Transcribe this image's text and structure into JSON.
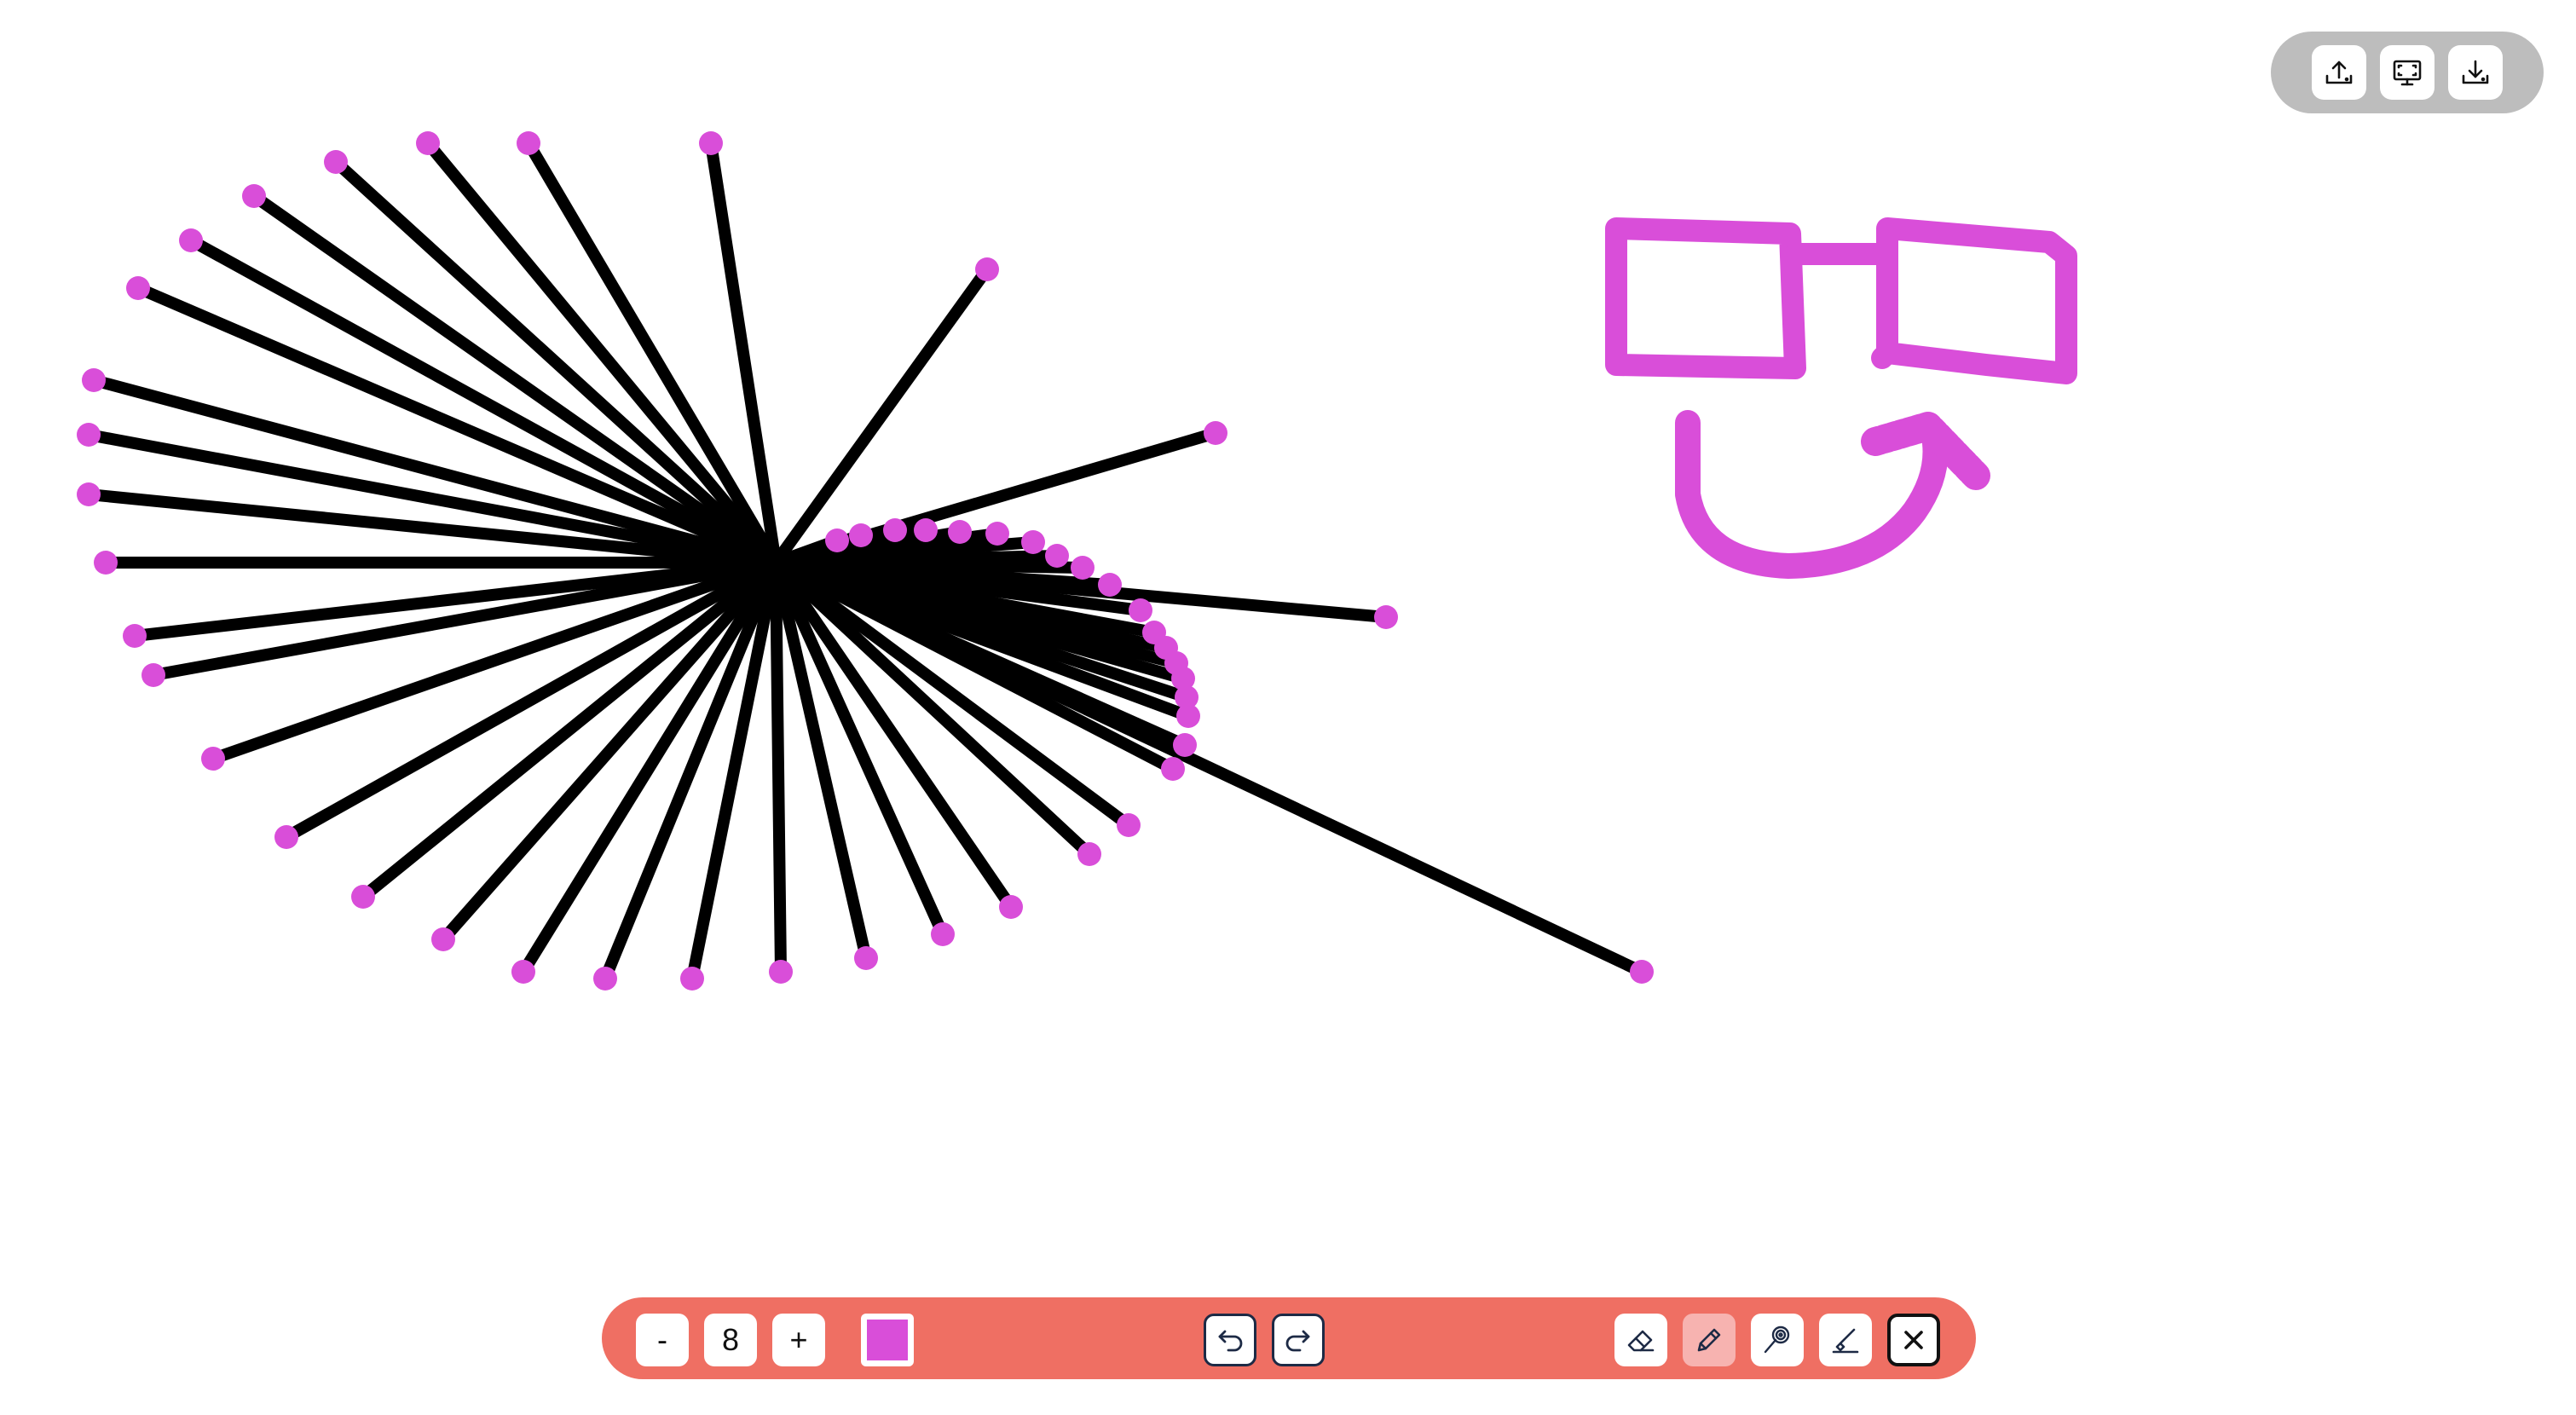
{
  "canvas": {
    "stroke_color": "#000000",
    "point_color": "#d94ed9",
    "drawing_color": "#d94ed9"
  },
  "top_panel": {
    "buttons": [
      {
        "name": "upload-button",
        "icon": "upload-icon"
      },
      {
        "name": "present-button",
        "icon": "screen-icon"
      },
      {
        "name": "download-button",
        "icon": "download-icon"
      }
    ]
  },
  "toolbar": {
    "decrease_label": "-",
    "size_value": "8",
    "increase_label": "+",
    "color_value": "#d94ed9",
    "undo_icon": "undo-icon",
    "redo_icon": "redo-icon",
    "tools": [
      {
        "name": "eraser-tool",
        "icon": "eraser-icon",
        "active": false
      },
      {
        "name": "pencil-tool",
        "icon": "pencil-icon",
        "active": true
      },
      {
        "name": "lasso-tool",
        "icon": "lasso-icon",
        "active": false
      },
      {
        "name": "highlighter-tool",
        "icon": "highlighter-icon",
        "active": false
      },
      {
        "name": "close-tool",
        "icon": "close-icon",
        "active": false
      }
    ],
    "accent_color": "#ef6f63",
    "active_tool_bg": "#f7b3b0"
  }
}
